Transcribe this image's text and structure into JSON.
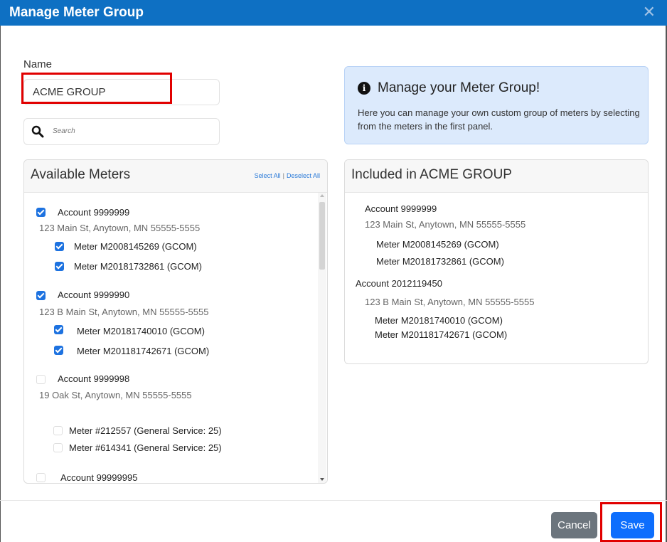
{
  "dialog": {
    "title": "Manage Meter Group"
  },
  "name_field": {
    "label": "Name",
    "value": "ACME GROUP"
  },
  "search": {
    "placeholder": "Search"
  },
  "info": {
    "title": "Manage your Meter Group!",
    "text": "Here you can manage your own custom group of meters by selecting from the meters in the first panel."
  },
  "available": {
    "title": "Available Meters",
    "select_all": "Select All",
    "separator": "|",
    "deselect_all": "Deselect All",
    "accounts": [
      {
        "name": "Account 9999999",
        "address": "123 Main St, Anytown, MN 55555-5555",
        "checked": true,
        "meters": [
          {
            "name": "Meter M2008145269 (GCOM)",
            "checked": true
          },
          {
            "name": "Meter M20181732861 (GCOM)",
            "checked": true
          }
        ]
      },
      {
        "name": "Account 9999990",
        "address": "123 B Main St, Anytown, MN 55555-5555",
        "checked": true,
        "meters": [
          {
            "name": "Meter M20181740010 (GCOM)",
            "checked": true
          },
          {
            "name": "Meter M201181742671 (GCOM)",
            "checked": true
          }
        ]
      },
      {
        "name": "Account 9999998",
        "address": "19 Oak St, Anytown, MN 55555-5555",
        "checked": false,
        "meters": [
          {
            "name": "Meter #212557 (General Service: 25)",
            "checked": false
          },
          {
            "name": "Meter #614341 (General Service: 25)",
            "checked": false
          }
        ]
      },
      {
        "name": "Account 99999995",
        "checked": false
      }
    ]
  },
  "included": {
    "title": "Included in ACME GROUP",
    "accounts": [
      {
        "name": "Account 9999999",
        "address": "123 Main St, Anytown, MN 55555-5555",
        "meters": [
          "Meter M2008145269 (GCOM)",
          "Meter M20181732861 (GCOM)"
        ]
      },
      {
        "name": "Account 2012119450",
        "address": "123 B Main St, Anytown, MN 55555-5555",
        "meters": [
          "Meter M20181740010 (GCOM)",
          "Meter M201181742671 (GCOM)"
        ]
      }
    ]
  },
  "footer": {
    "cancel": "Cancel",
    "save": "Save"
  },
  "colors": {
    "header": "#0e70c3",
    "checkbox": "#1d72e0",
    "save": "#0d6efd",
    "cancel": "#6c757d",
    "highlight": "#e10000"
  }
}
